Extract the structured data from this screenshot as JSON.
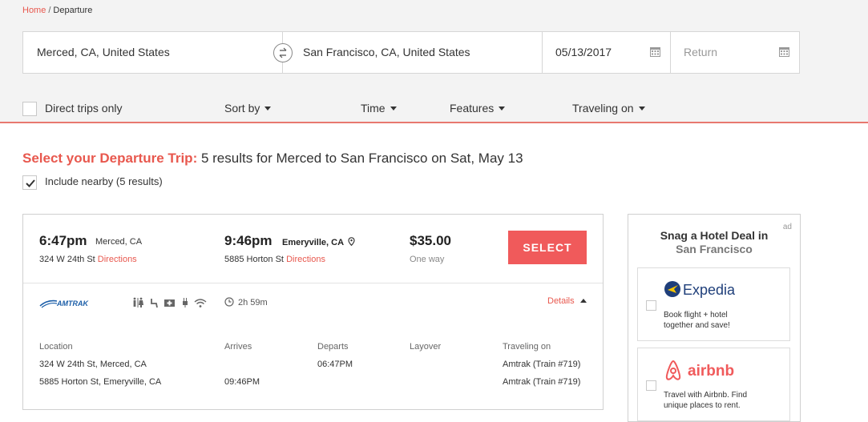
{
  "breadcrumb": {
    "home": "Home",
    "separator": "/",
    "current": "Departure"
  },
  "search": {
    "from": "Merced, CA, United States",
    "to": "San Francisco, CA, United States",
    "departure_date": "05/13/2017",
    "return_placeholder": "Return"
  },
  "filters": {
    "direct_only": "Direct trips only",
    "sort_by": "Sort by",
    "time": "Time",
    "features": "Features",
    "traveling_on": "Traveling on"
  },
  "results": {
    "heading_lead": "Select your Departure Trip:",
    "heading_rest": "5 results for Merced to San Francisco on Sat, May 13",
    "include_nearby": "Include nearby (5 results)"
  },
  "trip": {
    "depart_time": "6:47pm",
    "depart_city": "Merced, CA",
    "depart_address": "324 W 24th St",
    "arrive_time": "9:46pm",
    "arrive_city": "Emeryville, CA",
    "arrive_address": "5885 Horton St",
    "directions_label": "Directions",
    "price": "$35.00",
    "fare_type": "One way",
    "select_label": "SELECT",
    "carrier_logo": "AMTRAK",
    "duration": "2h 59m",
    "details_label": "Details",
    "amenities": [
      "restroom-icon",
      "seat-icon",
      "first-aid-icon",
      "power-outlet-icon",
      "wifi-icon"
    ],
    "details": {
      "headers": [
        "Location",
        "Arrives",
        "Departs",
        "Layover",
        "Traveling on"
      ],
      "rows": [
        {
          "location": "324 W 24th St, Merced, CA",
          "arrives": "",
          "departs": "06:47PM",
          "layover": "",
          "traveling_on": "Amtrak (Train #719)"
        },
        {
          "location": "5885 Horton St, Emeryville, CA",
          "arrives": "09:46PM",
          "departs": "",
          "layover": "",
          "traveling_on": "Amtrak (Train #719)"
        }
      ]
    }
  },
  "ad": {
    "tag": "ad",
    "title_line1": "Snag a Hotel Deal in",
    "title_line2": "San Francisco",
    "offers": [
      {
        "brand": "Expedia",
        "desc_line1": "Book flight + hotel",
        "desc_line2": "together and save!"
      },
      {
        "brand": "airbnb",
        "desc_line1": "Travel with Airbnb. Find",
        "desc_line2": "unique places to rent."
      }
    ]
  },
  "colors": {
    "accent": "#e8584e",
    "select_button": "#f05a5b",
    "expedia_blue": "#1f3f7a",
    "amtrak_blue": "#1b5ea8"
  }
}
